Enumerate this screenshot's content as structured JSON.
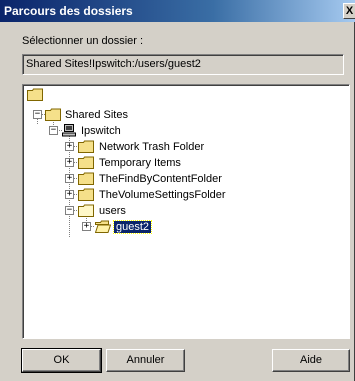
{
  "window": {
    "title": "Parcours des dossiers",
    "close_glyph": "X"
  },
  "prompt": {
    "label": "Sélectionner un dossier :"
  },
  "path": {
    "value": "Shared Sites!Ipswitch:/users/guest2"
  },
  "tree": {
    "root": {
      "icon": "folder-icon",
      "label": ""
    },
    "shared_sites": {
      "icon": "folder-icon",
      "label": "Shared Sites"
    },
    "ipswitch": {
      "icon": "computer-icon",
      "label": "Ipswitch"
    },
    "items": [
      {
        "label": "Network Trash Folder",
        "icon": "folder-icon"
      },
      {
        "label": "Temporary Items",
        "icon": "folder-icon"
      },
      {
        "label": "TheFindByContentFolder",
        "icon": "folder-icon"
      },
      {
        "label": "TheVolumeSettingsFolder",
        "icon": "folder-icon"
      },
      {
        "label": "users",
        "icon": "folder-icon"
      }
    ],
    "guest2": {
      "label": "guest2",
      "icon": "open-folder-icon"
    }
  },
  "buttons": {
    "ok": "OK",
    "cancel": "Annuler",
    "help": "Aide"
  },
  "colors": {
    "titlebar": "#0a246a",
    "selection": "#0a246a",
    "folder": "#f5e08a",
    "dialog_bg": "#d4d0c8"
  }
}
